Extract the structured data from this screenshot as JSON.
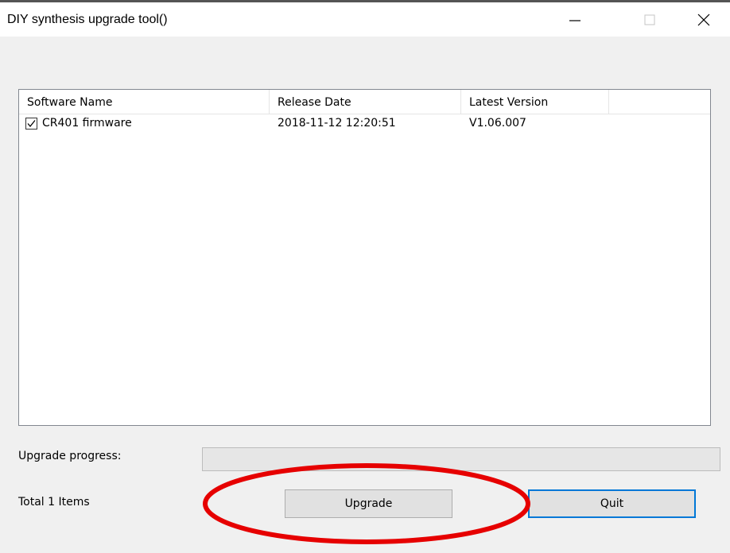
{
  "window": {
    "title": "DIY synthesis upgrade tool()",
    "controls": {
      "minimize_icon": "minimize-icon",
      "maximize_icon": "maximize-icon",
      "close_icon": "close-icon"
    }
  },
  "list": {
    "columns": [
      "Software Name",
      "Release Date",
      "Latest Version",
      ""
    ],
    "rows": [
      {
        "checked": true,
        "name": "CR401 firmware",
        "release_date": "2018-11-12 12:20:51",
        "version": "V1.06.007"
      }
    ]
  },
  "progress": {
    "label": "Upgrade progress:",
    "value_percent": 0
  },
  "footer": {
    "total_label": "Total 1 Items",
    "upgrade_button": "Upgrade",
    "quit_button": "Quit"
  },
  "colors": {
    "annotation_circle": "#e60000",
    "focus_border": "#0078d7"
  }
}
